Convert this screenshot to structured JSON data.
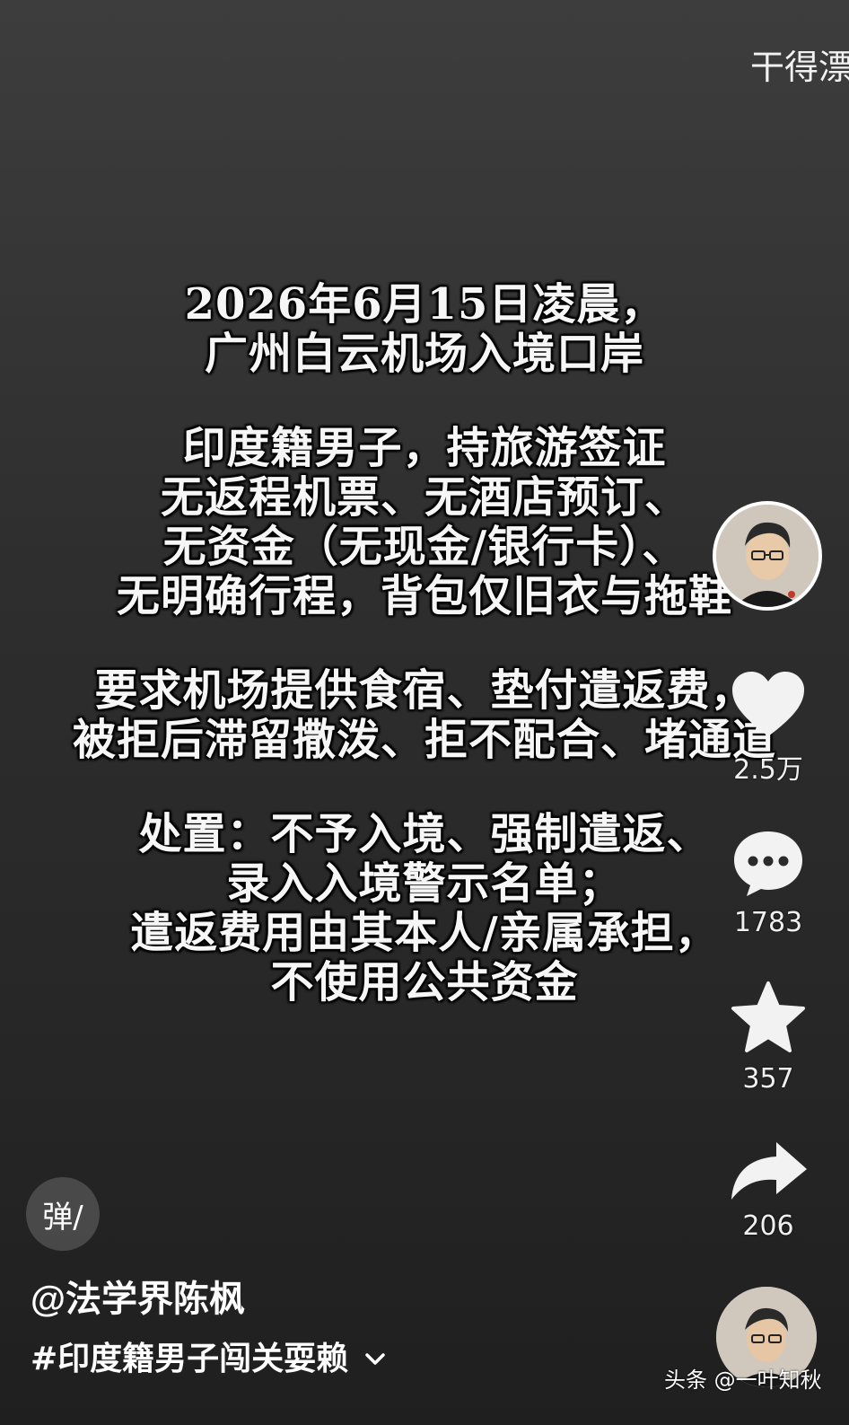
{
  "danmaku_text": "干得漂",
  "post_text": {
    "paragraphs": [
      [
        "2026年6月15日凌晨，",
        "广州白云机场入境口岸"
      ],
      [
        "印度籍男子，持旅游签证",
        "无返程机票、无酒店预订、",
        "无资金（无现金/银行卡）、",
        "无明确行程，背包仅旧衣与拖鞋"
      ],
      [
        "要求机场提供食宿、垫付遣返费，",
        "被拒后滞留撒泼、拒不配合、堵通道"
      ],
      [
        "处置：不予入境、强制遣返、",
        "录入入境警示名单；",
        "遣返费用由其本人/亲属承担，",
        "不使用公共资金"
      ]
    ]
  },
  "actions": {
    "like_count": "2.5万",
    "comment_count": "1783",
    "favorite_count": "357",
    "share_count": "206"
  },
  "danmaku_button": "弹/",
  "author": "@法学界陈枫",
  "hashtag": "#印度籍男子闯关耍赖",
  "watermark": "头条 @一叶知秋",
  "colors": {
    "background_top": "#3d3d3d",
    "background_bottom": "#1f1f1f",
    "text": "#ffffff"
  },
  "icons": [
    "heart-icon",
    "comment-icon",
    "star-icon",
    "share-icon",
    "chevron-down-icon"
  ]
}
